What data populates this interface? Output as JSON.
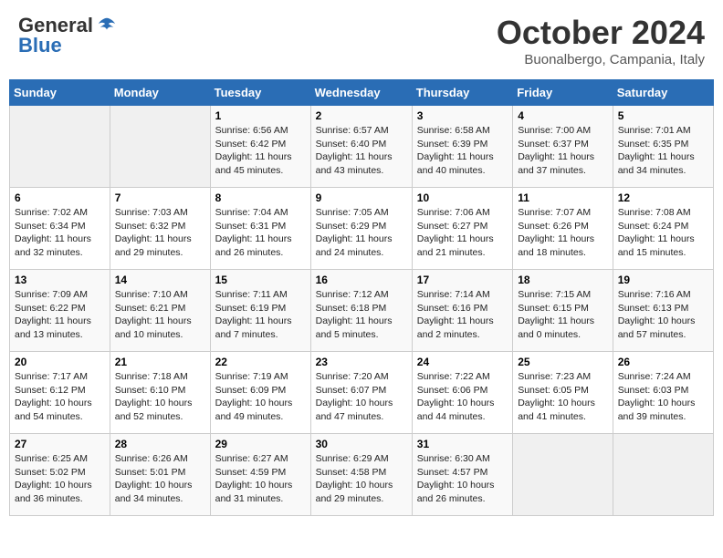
{
  "header": {
    "logo_general": "General",
    "logo_blue": "Blue",
    "month": "October 2024",
    "location": "Buonalbergo, Campania, Italy"
  },
  "weekdays": [
    "Sunday",
    "Monday",
    "Tuesday",
    "Wednesday",
    "Thursday",
    "Friday",
    "Saturday"
  ],
  "weeks": [
    [
      {
        "day": "",
        "info": ""
      },
      {
        "day": "",
        "info": ""
      },
      {
        "day": "1",
        "info": "Sunrise: 6:56 AM\nSunset: 6:42 PM\nDaylight: 11 hours and 45 minutes."
      },
      {
        "day": "2",
        "info": "Sunrise: 6:57 AM\nSunset: 6:40 PM\nDaylight: 11 hours and 43 minutes."
      },
      {
        "day": "3",
        "info": "Sunrise: 6:58 AM\nSunset: 6:39 PM\nDaylight: 11 hours and 40 minutes."
      },
      {
        "day": "4",
        "info": "Sunrise: 7:00 AM\nSunset: 6:37 PM\nDaylight: 11 hours and 37 minutes."
      },
      {
        "day": "5",
        "info": "Sunrise: 7:01 AM\nSunset: 6:35 PM\nDaylight: 11 hours and 34 minutes."
      }
    ],
    [
      {
        "day": "6",
        "info": "Sunrise: 7:02 AM\nSunset: 6:34 PM\nDaylight: 11 hours and 32 minutes."
      },
      {
        "day": "7",
        "info": "Sunrise: 7:03 AM\nSunset: 6:32 PM\nDaylight: 11 hours and 29 minutes."
      },
      {
        "day": "8",
        "info": "Sunrise: 7:04 AM\nSunset: 6:31 PM\nDaylight: 11 hours and 26 minutes."
      },
      {
        "day": "9",
        "info": "Sunrise: 7:05 AM\nSunset: 6:29 PM\nDaylight: 11 hours and 24 minutes."
      },
      {
        "day": "10",
        "info": "Sunrise: 7:06 AM\nSunset: 6:27 PM\nDaylight: 11 hours and 21 minutes."
      },
      {
        "day": "11",
        "info": "Sunrise: 7:07 AM\nSunset: 6:26 PM\nDaylight: 11 hours and 18 minutes."
      },
      {
        "day": "12",
        "info": "Sunrise: 7:08 AM\nSunset: 6:24 PM\nDaylight: 11 hours and 15 minutes."
      }
    ],
    [
      {
        "day": "13",
        "info": "Sunrise: 7:09 AM\nSunset: 6:22 PM\nDaylight: 11 hours and 13 minutes."
      },
      {
        "day": "14",
        "info": "Sunrise: 7:10 AM\nSunset: 6:21 PM\nDaylight: 11 hours and 10 minutes."
      },
      {
        "day": "15",
        "info": "Sunrise: 7:11 AM\nSunset: 6:19 PM\nDaylight: 11 hours and 7 minutes."
      },
      {
        "day": "16",
        "info": "Sunrise: 7:12 AM\nSunset: 6:18 PM\nDaylight: 11 hours and 5 minutes."
      },
      {
        "day": "17",
        "info": "Sunrise: 7:14 AM\nSunset: 6:16 PM\nDaylight: 11 hours and 2 minutes."
      },
      {
        "day": "18",
        "info": "Sunrise: 7:15 AM\nSunset: 6:15 PM\nDaylight: 11 hours and 0 minutes."
      },
      {
        "day": "19",
        "info": "Sunrise: 7:16 AM\nSunset: 6:13 PM\nDaylight: 10 hours and 57 minutes."
      }
    ],
    [
      {
        "day": "20",
        "info": "Sunrise: 7:17 AM\nSunset: 6:12 PM\nDaylight: 10 hours and 54 minutes."
      },
      {
        "day": "21",
        "info": "Sunrise: 7:18 AM\nSunset: 6:10 PM\nDaylight: 10 hours and 52 minutes."
      },
      {
        "day": "22",
        "info": "Sunrise: 7:19 AM\nSunset: 6:09 PM\nDaylight: 10 hours and 49 minutes."
      },
      {
        "day": "23",
        "info": "Sunrise: 7:20 AM\nSunset: 6:07 PM\nDaylight: 10 hours and 47 minutes."
      },
      {
        "day": "24",
        "info": "Sunrise: 7:22 AM\nSunset: 6:06 PM\nDaylight: 10 hours and 44 minutes."
      },
      {
        "day": "25",
        "info": "Sunrise: 7:23 AM\nSunset: 6:05 PM\nDaylight: 10 hours and 41 minutes."
      },
      {
        "day": "26",
        "info": "Sunrise: 7:24 AM\nSunset: 6:03 PM\nDaylight: 10 hours and 39 minutes."
      }
    ],
    [
      {
        "day": "27",
        "info": "Sunrise: 6:25 AM\nSunset: 5:02 PM\nDaylight: 10 hours and 36 minutes."
      },
      {
        "day": "28",
        "info": "Sunrise: 6:26 AM\nSunset: 5:01 PM\nDaylight: 10 hours and 34 minutes."
      },
      {
        "day": "29",
        "info": "Sunrise: 6:27 AM\nSunset: 4:59 PM\nDaylight: 10 hours and 31 minutes."
      },
      {
        "day": "30",
        "info": "Sunrise: 6:29 AM\nSunset: 4:58 PM\nDaylight: 10 hours and 29 minutes."
      },
      {
        "day": "31",
        "info": "Sunrise: 6:30 AM\nSunset: 4:57 PM\nDaylight: 10 hours and 26 minutes."
      },
      {
        "day": "",
        "info": ""
      },
      {
        "day": "",
        "info": ""
      }
    ]
  ]
}
